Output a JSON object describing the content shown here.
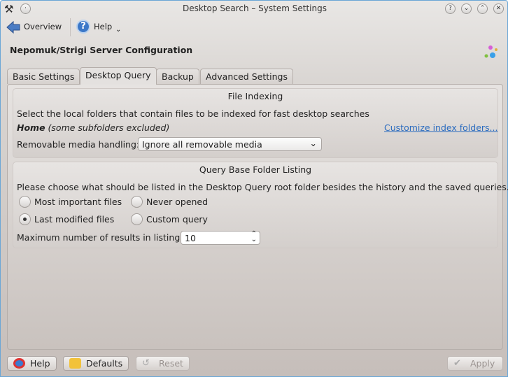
{
  "window": {
    "title": "Desktop Search – System Settings",
    "buttons": [
      "?",
      "⌄",
      "⌃",
      "✕"
    ]
  },
  "toolbar": {
    "overview_label": "Overview",
    "help_label": "Help"
  },
  "header": {
    "title": "Nepomuk/Strigi Server Configuration"
  },
  "tabs": [
    {
      "label": "Basic Settings",
      "active": false
    },
    {
      "label": "Desktop Query",
      "active": true
    },
    {
      "label": "Backup",
      "active": false
    },
    {
      "label": "Advanced Settings",
      "active": false
    }
  ],
  "file_indexing": {
    "title": "File Indexing",
    "description": "Select the local folders that contain files to be indexed for fast desktop searches",
    "folder_name": "Home",
    "folder_note": "(some subfolders excluded)",
    "customize_link": "Customize index folders...",
    "removable_label": "Removable media handling:",
    "removable_value": "Ignore all removable media"
  },
  "query_listing": {
    "title": "Query Base Folder Listing",
    "description": "Please choose what should be listed in the Desktop Query root folder besides the history and the saved queries.",
    "options": [
      {
        "label": "Most important files",
        "checked": false
      },
      {
        "label": "Never opened",
        "checked": false
      },
      {
        "label": "Last modified files",
        "checked": true
      },
      {
        "label": "Custom query",
        "checked": false
      }
    ],
    "max_label": "Maximum number of results in listing:",
    "max_value": "10"
  },
  "footer": {
    "help": "Help",
    "defaults": "Defaults",
    "reset": "Reset",
    "apply": "Apply"
  },
  "colors": {
    "link": "#2a6bbf",
    "accent": "#6aa6d6"
  }
}
